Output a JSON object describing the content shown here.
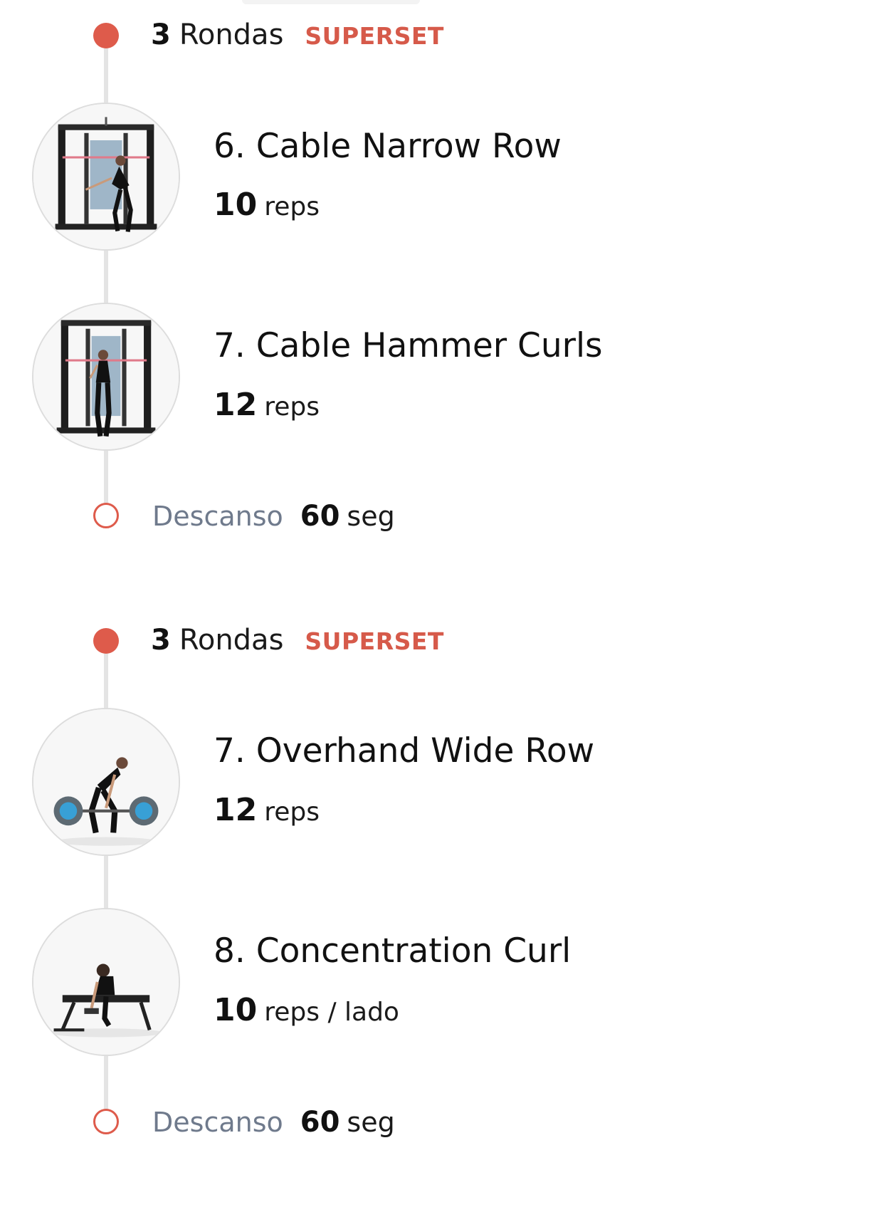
{
  "groups": [
    {
      "rounds_num": "3",
      "rounds_label": "Rondas",
      "tag": "SUPERSET",
      "exercises": [
        {
          "name": "6. Cable Narrow Row",
          "reps_num": "10",
          "reps_unit": "reps",
          "image": "cable-machine-row"
        },
        {
          "name": "7. Cable Hammer Curls",
          "reps_num": "12",
          "reps_unit": "reps",
          "image": "cable-machine-curl"
        }
      ],
      "rest": {
        "label": "Descanso",
        "num": "60",
        "unit": "seg"
      }
    },
    {
      "rounds_num": "3",
      "rounds_label": "Rondas",
      "tag": "SUPERSET",
      "exercises": [
        {
          "name": "7. Overhand Wide Row",
          "reps_num": "12",
          "reps_unit": "reps",
          "image": "barbell-row"
        },
        {
          "name": "8. Concentration Curl",
          "reps_num": "10",
          "reps_unit": "reps / lado",
          "image": "bench-dumbbell-curl"
        }
      ],
      "rest": {
        "label": "Descanso",
        "num": "60",
        "unit": "seg"
      }
    }
  ],
  "colors": {
    "accent": "#de5b4b",
    "rail": "#e4e4e4",
    "rest_label": "#6f7a8c"
  }
}
